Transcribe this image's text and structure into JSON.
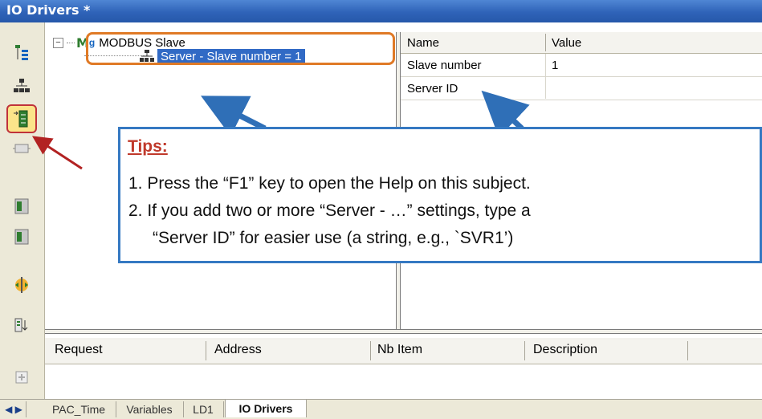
{
  "window": {
    "title": "IO Drivers *"
  },
  "toolbar": {
    "icons": [
      "tree-icon",
      "network-icon",
      "insert-driver-icon",
      "card-icon",
      "move-up-icon",
      "move-down-icon",
      "split-icon",
      "sort-icon",
      "add-variable-icon"
    ]
  },
  "tree": {
    "root_label": "MODBUS Slave",
    "root_badge": "M",
    "child_label": "Server - Slave number = 1"
  },
  "properties": {
    "col_name": "Name",
    "col_value": "Value",
    "rows": [
      {
        "name": "Slave number",
        "value": "1"
      },
      {
        "name": "Server ID",
        "value": ""
      }
    ]
  },
  "grid": {
    "columns": [
      "Request",
      "Address",
      "Nb Item",
      "Description"
    ]
  },
  "tabs": [
    "PAC_Time",
    "Variables",
    "LD1",
    "IO Drivers"
  ],
  "tips": {
    "title": "Tips:",
    "line1": "1.  Press the “F1” key to open the Help on this subject.",
    "line2": "2.  If you add two or more “Server - …” settings, type a",
    "line3": "“Server ID” for easier use (a string, e.g., `SVR1’)"
  },
  "colors": {
    "highlight_outline": "#e07a26",
    "callout_blue": "#2f6fb7",
    "red_arrow": "#b22222",
    "selection": "#316ac5"
  }
}
